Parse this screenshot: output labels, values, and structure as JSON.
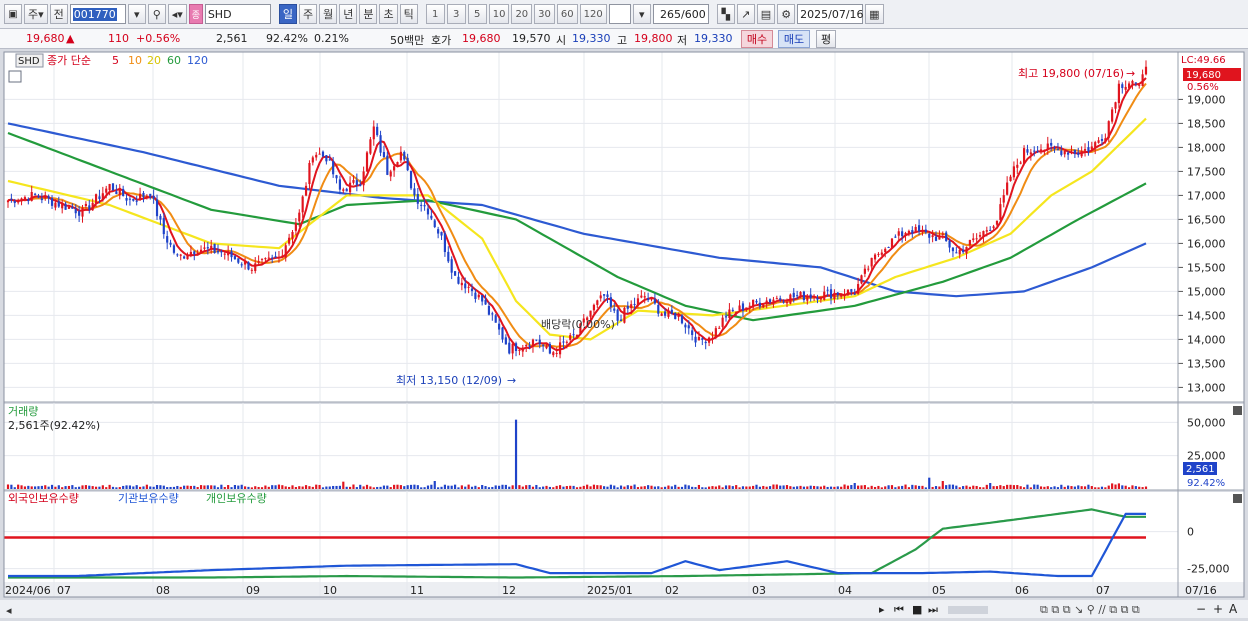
{
  "toolbar": {
    "period_main": "주",
    "prev_label": "전",
    "stock_code": "001770",
    "ticker": "SHD",
    "periods": [
      "일",
      "주",
      "월",
      "년",
      "분",
      "초",
      "틱"
    ],
    "active_period": "일",
    "intervals": [
      "1",
      "3",
      "5",
      "10",
      "20",
      "30",
      "60",
      "120"
    ],
    "view_count": "265",
    "view_total": "/600",
    "date": "2025/07/16"
  },
  "infobar": {
    "price": "19,680",
    "change_arrow": "▲",
    "change": "110",
    "change_pct": "+0.56%",
    "volume": "2,561",
    "volume_ratio": "92.42%",
    "turnover": "0.21%",
    "trade_value": "50백만",
    "quote_label": "호가",
    "ask": "19,680",
    "bid": "19,570",
    "open_label": "시",
    "open": "19,330",
    "high_label": "고",
    "high": "19,800",
    "low_label": "저",
    "low": "19,330",
    "buy_label": "매수",
    "sell_label": "매도",
    "eval_label": "평"
  },
  "price_panel": {
    "ticker_tag": "SHD",
    "legend_prefix": "종가 단순",
    "ma_periods": [
      "5",
      "10",
      "20",
      "60",
      "120"
    ],
    "lc_label": "LC:49.66",
    "last_price_tag": "19,680",
    "last_pct_tag": "0.56%",
    "high_annotation": "최고 19,800 (07/16)",
    "low_annotation": "최저 13,150 (12/09)",
    "dividend_annotation": "배당락(0.00%)"
  },
  "volume_panel": {
    "title": "거래량",
    "current": "2,561주(92.42%)",
    "last_tag": "2,561",
    "pct_tag": "92.42%"
  },
  "holdings_panel": {
    "series_labels": [
      "외국인보유수량",
      "기관보유수량",
      "개인보유수량"
    ]
  },
  "colors": {
    "up": "#e0141e",
    "down": "#1f43c9",
    "ma5": "#e0141e",
    "ma10": "#f08c14",
    "ma20": "#f5e61e",
    "ma60": "#239b3c",
    "ma120": "#2d5ad2",
    "foreign": "#1f56d6",
    "institution": "#2a9a4a",
    "reference_line": "#e0141e"
  },
  "chart_data": {
    "type": "candlestick",
    "x_axis_labels": [
      "2024/06",
      "07",
      "08",
      "09",
      "10",
      "11",
      "12",
      "2025/01",
      "02",
      "03",
      "04",
      "05",
      "06",
      "07",
      "07/16"
    ],
    "price_axis_ticks": [
      "19,000",
      "18,500",
      "18,000",
      "17,500",
      "17,000",
      "16,500",
      "16,000",
      "15,500",
      "15,000",
      "14,500",
      "14,000",
      "13,500",
      "13,000"
    ],
    "price_range": [
      12800,
      19800
    ],
    "volume_axis_ticks": [
      "50,000",
      "25,000"
    ],
    "volume_range": [
      0,
      60000
    ],
    "holdings_axis_ticks": [
      "0",
      "-25,000"
    ],
    "holdings_range": [
      -32000,
      18000
    ],
    "close_path": [
      [
        0,
        16900
      ],
      [
        8,
        17000
      ],
      [
        16,
        16800
      ],
      [
        22,
        16650
      ],
      [
        30,
        17200
      ],
      [
        36,
        16900
      ],
      [
        42,
        17050
      ],
      [
        46,
        16200
      ],
      [
        50,
        15700
      ],
      [
        56,
        15900
      ],
      [
        64,
        15800
      ],
      [
        72,
        15500
      ],
      [
        80,
        15700
      ],
      [
        86,
        16600
      ],
      [
        90,
        17900
      ],
      [
        94,
        17800
      ],
      [
        98,
        17100
      ],
      [
        104,
        17300
      ],
      [
        108,
        18400
      ],
      [
        112,
        17500
      ],
      [
        116,
        17900
      ],
      [
        120,
        17000
      ],
      [
        124,
        16700
      ],
      [
        128,
        16100
      ],
      [
        132,
        15300
      ],
      [
        136,
        15100
      ],
      [
        140,
        14800
      ],
      [
        144,
        14300
      ],
      [
        148,
        13800
      ],
      [
        152,
        13900
      ],
      [
        156,
        14000
      ],
      [
        160,
        13700
      ],
      [
        164,
        13900
      ],
      [
        168,
        14100
      ],
      [
        172,
        14600
      ],
      [
        176,
        14900
      ],
      [
        180,
        14400
      ],
      [
        184,
        14700
      ],
      [
        188,
        14900
      ],
      [
        194,
        14500
      ],
      [
        198,
        14500
      ],
      [
        204,
        13950
      ],
      [
        208,
        14100
      ],
      [
        212,
        14500
      ],
      [
        218,
        14700
      ],
      [
        226,
        14850
      ],
      [
        234,
        14900
      ],
      [
        242,
        14950
      ],
      [
        250,
        15000
      ],
      [
        254,
        15500
      ],
      [
        258,
        15900
      ],
      [
        262,
        16100
      ],
      [
        266,
        16300
      ],
      [
        270,
        16200
      ],
      [
        276,
        16100
      ],
      [
        280,
        15800
      ],
      [
        286,
        16100
      ],
      [
        292,
        16500
      ],
      [
        296,
        17400
      ],
      [
        300,
        17900
      ],
      [
        304,
        18000
      ],
      [
        310,
        17950
      ],
      [
        316,
        17900
      ],
      [
        320,
        18000
      ],
      [
        324,
        18300
      ],
      [
        328,
        19300
      ],
      [
        332,
        19400
      ],
      [
        334,
        19200
      ],
      [
        336,
        19680
      ]
    ],
    "ma_paths": {
      "ma20": [
        [
          0,
          17300
        ],
        [
          30,
          16800
        ],
        [
          60,
          16000
        ],
        [
          80,
          15900
        ],
        [
          100,
          17000
        ],
        [
          124,
          17000
        ],
        [
          140,
          16100
        ],
        [
          150,
          14800
        ],
        [
          160,
          14100
        ],
        [
          172,
          14000
        ],
        [
          186,
          14600
        ],
        [
          208,
          14500
        ],
        [
          250,
          14900
        ],
        [
          262,
          15300
        ],
        [
          280,
          15700
        ],
        [
          296,
          16200
        ],
        [
          308,
          17000
        ],
        [
          320,
          17500
        ],
        [
          336,
          18600
        ]
      ],
      "ma60": [
        [
          0,
          18300
        ],
        [
          30,
          17500
        ],
        [
          60,
          16700
        ],
        [
          86,
          16400
        ],
        [
          100,
          16800
        ],
        [
          124,
          16900
        ],
        [
          150,
          16500
        ],
        [
          180,
          15300
        ],
        [
          200,
          14700
        ],
        [
          220,
          14400
        ],
        [
          250,
          14700
        ],
        [
          276,
          15200
        ],
        [
          296,
          15700
        ],
        [
          316,
          16500
        ],
        [
          336,
          17250
        ]
      ],
      "ma120": [
        [
          0,
          18500
        ],
        [
          40,
          17900
        ],
        [
          80,
          17200
        ],
        [
          110,
          16950
        ],
        [
          140,
          16800
        ],
        [
          170,
          16200
        ],
        [
          210,
          15700
        ],
        [
          240,
          15500
        ],
        [
          262,
          15000
        ],
        [
          280,
          14900
        ],
        [
          300,
          15000
        ],
        [
          320,
          15500
        ],
        [
          336,
          16000
        ]
      ]
    },
    "holdings": {
      "foreign": [
        [
          0,
          -30000
        ],
        [
          20,
          -30000
        ],
        [
          60,
          -26000
        ],
        [
          100,
          -23000
        ],
        [
          150,
          -22000
        ],
        [
          160,
          -28000
        ],
        [
          190,
          -28000
        ],
        [
          200,
          -20000
        ],
        [
          210,
          -26000
        ],
        [
          230,
          -20000
        ],
        [
          245,
          -28000
        ],
        [
          270,
          -28000
        ],
        [
          290,
          -27000
        ],
        [
          310,
          -30000
        ],
        [
          320,
          -30000
        ],
        [
          330,
          12000
        ],
        [
          336,
          12000
        ]
      ],
      "institution": [
        [
          0,
          -31000
        ],
        [
          60,
          -31000
        ],
        [
          100,
          -30000
        ],
        [
          150,
          -31000
        ],
        [
          200,
          -30000
        ],
        [
          255,
          -28000
        ],
        [
          268,
          -12000
        ],
        [
          276,
          2000
        ],
        [
          290,
          6000
        ],
        [
          310,
          12000
        ],
        [
          320,
          15000
        ],
        [
          330,
          10000
        ],
        [
          336,
          10000
        ]
      ],
      "reference_level": -4000
    }
  }
}
